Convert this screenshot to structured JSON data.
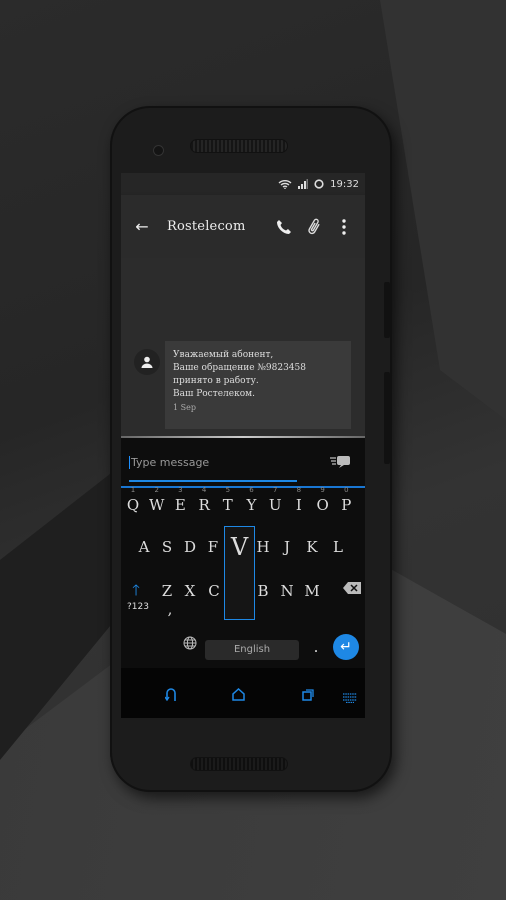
{
  "status_bar": {
    "time": "19:32",
    "icons": [
      "wifi-icon",
      "signal-icon",
      "battery-ring-icon"
    ]
  },
  "app_bar": {
    "title": "Rostelecom",
    "back_icon": "arrow-left-icon",
    "actions": [
      "phone-icon",
      "paperclip-icon",
      "more-vert-icon"
    ]
  },
  "message": {
    "lines": [
      "Уважаемый абонент,",
      "Ваше обращение №9823458",
      "принято в работу.",
      "Ваш Ростелеком.",
      "1 Sep"
    ],
    "avatar_icon": "person-icon"
  },
  "composer": {
    "placeholder": "Type message",
    "send_icon": "quick-reply-icon"
  },
  "keyboard": {
    "row1": [
      {
        "k": "Q",
        "n": "1"
      },
      {
        "k": "W",
        "n": "2"
      },
      {
        "k": "E",
        "n": "3"
      },
      {
        "k": "R",
        "n": "4"
      },
      {
        "k": "T",
        "n": "5"
      },
      {
        "k": "Y",
        "n": "6"
      },
      {
        "k": "U",
        "n": "7"
      },
      {
        "k": "I",
        "n": "8"
      },
      {
        "k": "O",
        "n": "9"
      },
      {
        "k": "P",
        "n": "0"
      }
    ],
    "row2": [
      "A",
      "S",
      "D",
      "F",
      "H",
      "J",
      "K",
      "L"
    ],
    "row3": [
      "Z",
      "X",
      "C",
      "B",
      "N",
      "M"
    ],
    "popup_key": "V",
    "symbols_label": "?123",
    "comma": ",",
    "period": ".",
    "space_label": "English",
    "accent_color": "#1e88e5"
  },
  "nav_bar": {
    "icons": [
      "back-icon",
      "home-icon",
      "recents-icon",
      "keyboard-icon"
    ]
  }
}
